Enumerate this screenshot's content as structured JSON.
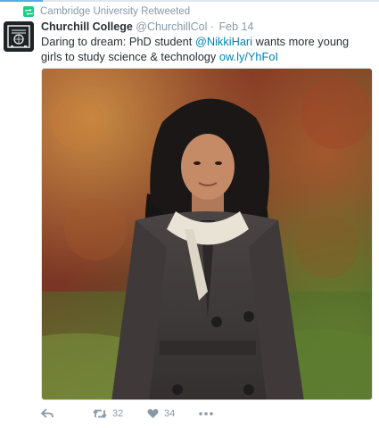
{
  "context": {
    "retweet_label": "Cambridge University Retweeted",
    "retweet_icon": "retweet-icon",
    "icon_color": "#19cf86"
  },
  "tweet": {
    "author": {
      "fullname": "Churchill College",
      "screen_name": "@ChurchillCol",
      "avatar": "churchill-college-crest"
    },
    "separator": "·",
    "timestamp": "Feb 14",
    "text": {
      "before_mention": "Daring to dream: PhD student ",
      "mention": "@NikkiHari",
      "after_mention": " wants more young girls to study science & technology ",
      "link": "ow.ly/YhFoI"
    },
    "media": {
      "alt": "Photo of a woman in a grey coat and white scarf standing in front of autumn trees"
    },
    "actions": {
      "reply_icon": "reply-icon",
      "retweet_icon": "retweet-icon",
      "retweet_count": "32",
      "like_icon": "heart-icon",
      "like_count": "34",
      "more_icon": "more-icon"
    }
  },
  "colors": {
    "link": "#0084b4",
    "muted": "#8899a6",
    "text": "#292f33",
    "accent": "#55acee"
  }
}
